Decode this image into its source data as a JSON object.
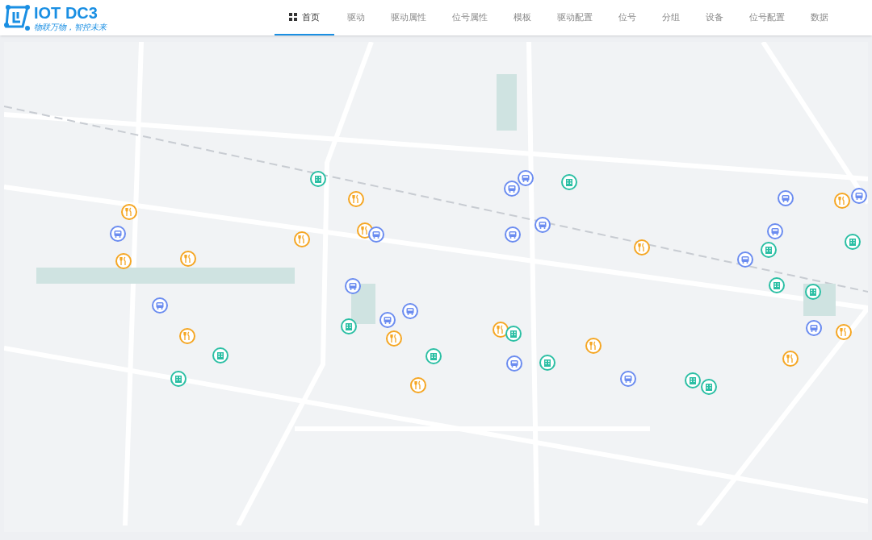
{
  "logo": {
    "title": "IOT DC3",
    "slogan": "物联万物，智控未来"
  },
  "nav": [
    {
      "label": "首页",
      "selected": true,
      "kind": "home"
    },
    {
      "label": "驱动",
      "selected": false
    },
    {
      "label": "驱动属性",
      "selected": false
    },
    {
      "label": "位号属性",
      "selected": false
    },
    {
      "label": "模板",
      "selected": false
    },
    {
      "label": "驱动配置",
      "selected": false
    },
    {
      "label": "位号",
      "selected": false
    },
    {
      "label": "分组",
      "selected": false
    },
    {
      "label": "设备",
      "selected": false
    },
    {
      "label": "位号配置",
      "selected": false
    },
    {
      "label": "数据",
      "selected": false
    }
  ],
  "map": {
    "markers": [
      {
        "kind": "building"
      },
      {
        "kind": "restaurant"
      },
      {
        "kind": "restaurant"
      },
      {
        "kind": "bus"
      },
      {
        "kind": "restaurant"
      },
      {
        "kind": "restaurant"
      },
      {
        "kind": "bus"
      },
      {
        "kind": "restaurant"
      },
      {
        "kind": "restaurant"
      },
      {
        "kind": "bus"
      },
      {
        "kind": "bus"
      },
      {
        "kind": "bus"
      },
      {
        "kind": "bus"
      },
      {
        "kind": "building"
      },
      {
        "kind": "restaurant"
      },
      {
        "kind": "restaurant"
      },
      {
        "kind": "building"
      },
      {
        "kind": "building"
      },
      {
        "kind": "building"
      },
      {
        "kind": "restaurant"
      },
      {
        "kind": "bus"
      },
      {
        "kind": "bus"
      },
      {
        "kind": "building"
      },
      {
        "kind": "bus"
      },
      {
        "kind": "bus"
      },
      {
        "kind": "restaurant"
      },
      {
        "kind": "restaurant"
      },
      {
        "kind": "building"
      },
      {
        "kind": "bus"
      },
      {
        "kind": "building"
      },
      {
        "kind": "restaurant"
      },
      {
        "kind": "bus"
      },
      {
        "kind": "building"
      },
      {
        "kind": "building"
      },
      {
        "kind": "bus"
      },
      {
        "kind": "bus"
      },
      {
        "kind": "restaurant"
      },
      {
        "kind": "bus"
      },
      {
        "kind": "building"
      },
      {
        "kind": "building"
      },
      {
        "kind": "bus"
      },
      {
        "kind": "building"
      },
      {
        "kind": "building"
      },
      {
        "kind": "bus"
      },
      {
        "kind": "restaurant"
      },
      {
        "kind": "restaurant"
      }
    ]
  }
}
